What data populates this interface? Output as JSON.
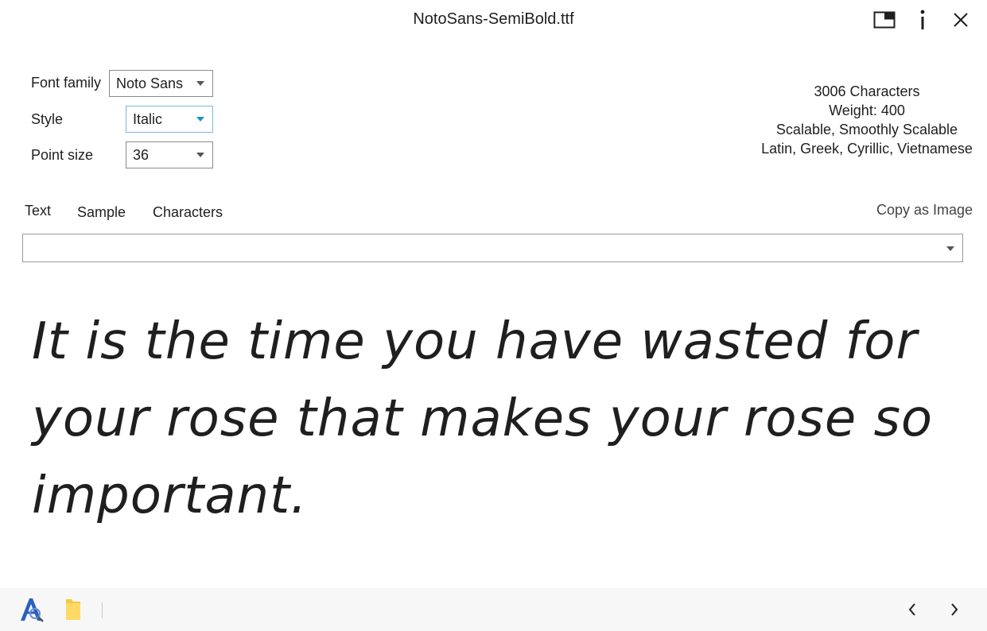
{
  "window": {
    "title": "NotoSans-SemiBold.ttf"
  },
  "controls": {
    "font_family_label": "Font family",
    "font_family_value": "Noto Sans",
    "style_label": "Style",
    "style_value": "Italic",
    "point_size_label": "Point size",
    "point_size_value": "36"
  },
  "font_info": {
    "characters": "3006 Characters",
    "weight": "Weight: 400",
    "scalable": "Scalable, Smoothly Scalable",
    "scripts": "Latin, Greek, Cyrillic, Vietnamese"
  },
  "tabs": [
    {
      "label": "Text",
      "selected": true
    },
    {
      "label": "Sample",
      "selected": false
    },
    {
      "label": "Characters",
      "selected": false
    }
  ],
  "copy_as_image_label": "Copy as Image",
  "text_input": {
    "value": "",
    "placeholder": ""
  },
  "preview_text": "It is the time you have wasted for\nyour rose that makes your rose so\nimportant.",
  "icons": {
    "compact": "compact-overlay-icon",
    "info": "info-icon",
    "close": "close-icon",
    "app": "font-app-icon",
    "folder": "folder-icon",
    "prev": "chevron-left-icon",
    "next": "chevron-right-icon"
  },
  "colors": {
    "accent_focus": "#7ab9d8",
    "folder_yellow": "#f5c842",
    "bottom_bar": "#f7f7f7"
  }
}
